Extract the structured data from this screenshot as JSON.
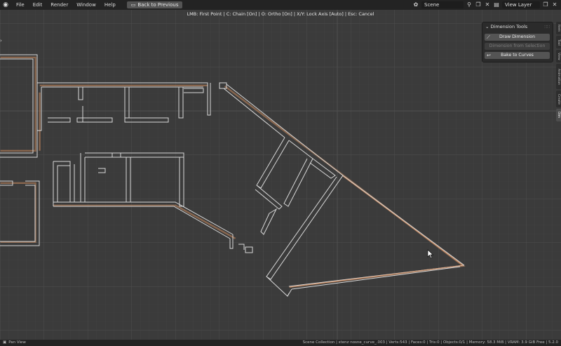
{
  "menubar": {
    "items": [
      "File",
      "Edit",
      "Render",
      "Window",
      "Help"
    ],
    "back_button": "Back to Previous",
    "scene": "Scene",
    "view_layer": "View Layer"
  },
  "viewport": {
    "header_hint": "LMB: First Point | C: Chain [On] | O: Ortho [On] | X/Y: Lock Axis [Auto] | Esc: Cancel"
  },
  "panel": {
    "title": "Dimension Tools",
    "buttons": [
      {
        "label": "Draw Dimension",
        "enabled": true,
        "icon": "ruler-icon"
      },
      {
        "label": "Dimension from Selection",
        "enabled": false,
        "icon": ""
      },
      {
        "label": "Bake to Curves",
        "enabled": true,
        "icon": "curve-icon"
      }
    ]
  },
  "side_tabs": [
    "Item",
    "Tool",
    "View",
    "Animation",
    "Create",
    "Dim"
  ],
  "statusbar": {
    "left": "Pan View",
    "right": "Scene Collection | stenz nosne_curve_.003 | Verts:543 | Faces:0 | Tris:0 | Objects:0/1 | Memory: 58.3 MiB | VRAM: 3.9 GiB Free | 5.2.0"
  },
  "colors": {
    "viewport_bg": "#3b3b3b",
    "grid_minor": "#444444",
    "grid_major": "#4e4e4e",
    "wall_line": "#d6d6d6",
    "wall_accent": "#e0a070"
  }
}
